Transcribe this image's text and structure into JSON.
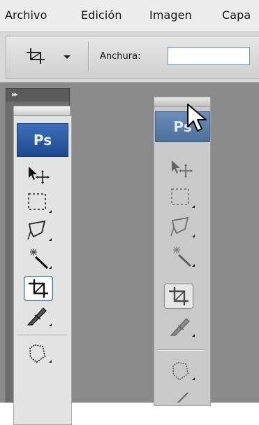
{
  "menu": {
    "items": [
      "Archivo",
      "Edición",
      "Imagen",
      "Capa"
    ]
  },
  "options_bar": {
    "width_label": "Anchura:",
    "width_value": ""
  },
  "dock": {
    "collapse_arrows": "▸▸",
    "logo": "Ps"
  },
  "floating_panel": {
    "logo": "Ps"
  },
  "tools": [
    "move-tool",
    "marquee-tool",
    "lasso-tool",
    "magic-wand-tool",
    "crop-tool",
    "slice-tool",
    "clone-stamp-tool"
  ],
  "active_tool": "crop-tool"
}
